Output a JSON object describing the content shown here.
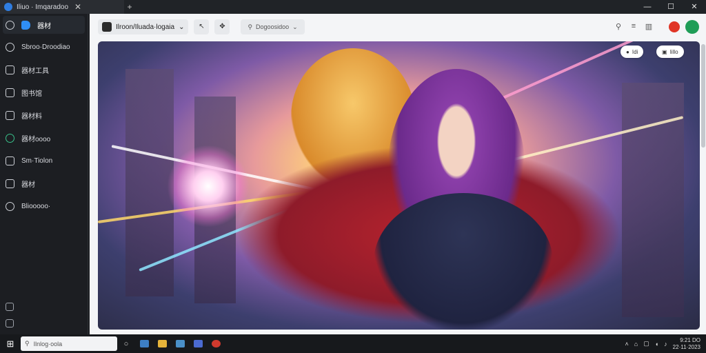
{
  "titlebar": {
    "tab_label": "Iliuo · Imqaradoo",
    "new_tab": "+",
    "window_controls": [
      "—",
      "☐",
      "✕"
    ]
  },
  "sidebar": {
    "items": [
      {
        "label": "器材",
        "icon": "bookmark-icon"
      },
      {
        "label": "Sbroo·Droodiao",
        "icon": "settings-icon"
      },
      {
        "label": "器材工具",
        "icon": "pen-icon"
      },
      {
        "label": "图书馆",
        "icon": "library-icon"
      },
      {
        "label": "器材料",
        "icon": "page-icon"
      },
      {
        "label": "器材oooo",
        "icon": "status-icon"
      },
      {
        "label": "Sm·Tiolon",
        "icon": "clipboard-icon"
      },
      {
        "label": "器材",
        "icon": "bag-icon"
      },
      {
        "label": "Bliooooo·",
        "icon": "info-icon"
      }
    ]
  },
  "toolbar": {
    "path_label": "Ilroon/Iluada·logaia",
    "search_label": "Dogoosidoo",
    "colors": {
      "accent_red": "#e03526",
      "accent_green": "#1f9d57"
    }
  },
  "viewer": {
    "chip_left": "Idi",
    "chip_right": "Iillo"
  },
  "taskbar": {
    "search_placeholder": "Ilnlog·oola",
    "clock_time": "9:21 DO",
    "clock_date": "22·11·2023"
  }
}
